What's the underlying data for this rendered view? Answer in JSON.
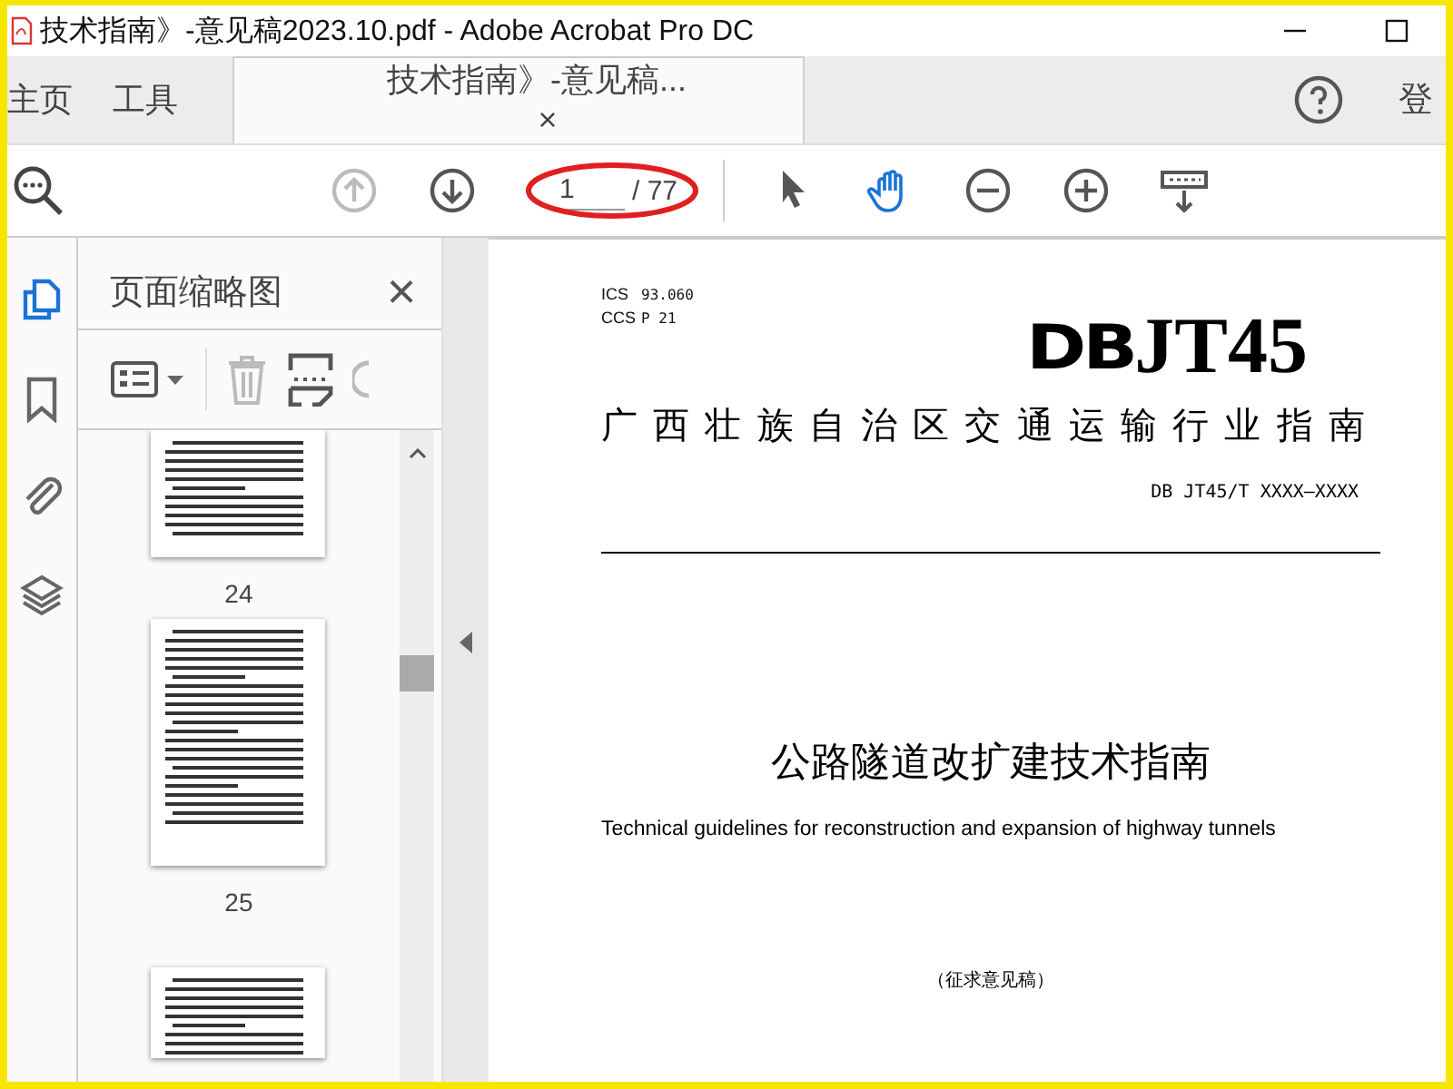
{
  "window": {
    "title": "技术指南》-意见稿2023.10.pdf - Adobe Acrobat Pro DC"
  },
  "tabs": [
    {
      "kind": "nav",
      "label": "主页",
      "selected": false
    },
    {
      "kind": "nav",
      "label": "工具",
      "selected": false
    },
    {
      "kind": "document",
      "label": "技术指南》-意见稿...",
      "close": "×",
      "selected": true
    }
  ],
  "account": {
    "label": "登"
  },
  "toolbar": {
    "page_input": "1",
    "page_total": "/ 77",
    "tools": [
      {
        "kind": "prev-page",
        "disabled": true
      },
      {
        "kind": "next-page",
        "disabled": false
      },
      {
        "kind": "select",
        "selected": false
      },
      {
        "kind": "hand",
        "selected": true
      },
      {
        "kind": "zoom-out",
        "disabled": false
      },
      {
        "kind": "zoom-in",
        "disabled": false
      },
      {
        "kind": "scroll-mode",
        "disabled": false
      }
    ]
  },
  "sidebar": {
    "items": [
      {
        "kind": "pages",
        "selected": true
      },
      {
        "kind": "bookmarks",
        "selected": false
      },
      {
        "kind": "attachments",
        "selected": false
      },
      {
        "kind": "layers",
        "selected": false
      }
    ]
  },
  "thumbnails_panel": {
    "title": "页面缩略图",
    "close": "×",
    "pages": [
      {
        "kind": "top-cut",
        "label": "24"
      },
      {
        "kind": "full",
        "label": "25"
      },
      {
        "kind": "bottom-cut"
      }
    ]
  },
  "document": {
    "ics_label": "ICS",
    "ics_value": "93.060",
    "ccs_label": "CCS",
    "ccs_value": "P 21",
    "logo_bold": "DB",
    "logo_rest": "JT45",
    "issuer": "广西壮族自治区交通运输行业指南",
    "code": "DB JT45/T XXXX—XXXX",
    "title": "公路隧道改扩建技术指南",
    "subtitle": "Technical guidelines for reconstruction and expansion of highway tunnels",
    "note": "（征求意见稿）"
  }
}
